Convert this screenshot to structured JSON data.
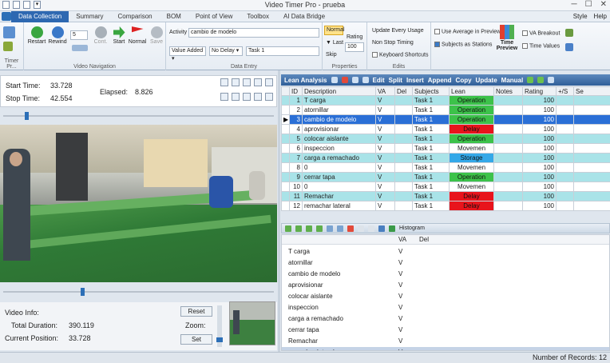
{
  "window": {
    "title": "Video Timer Pro - prueba"
  },
  "tabs": [
    "Data Collection",
    "Summary",
    "Comparison",
    "BOM",
    "Point of View",
    "Toolbox",
    "AI Data Bridge"
  ],
  "tab_right": {
    "style": "Style",
    "help": "Help"
  },
  "ribbon": {
    "groups": {
      "timer": "Timer Pr...",
      "nav": "Video Navigation",
      "entry": "Data Entry",
      "props": "Properties",
      "edits": "Edits"
    },
    "nav": {
      "restart": "Restart",
      "rewind": "Rewind",
      "step": "5",
      "cont": "Cont.",
      "start": "Start",
      "normal": "Normal",
      "save": "Save"
    },
    "entry": {
      "activity_label": "Activity",
      "activity_value": "cambio de modelo",
      "value_added": "Value Added",
      "no_delay": "No Delay",
      "task": "Task 1"
    },
    "props": {
      "normal": "Normal",
      "rating_label": "Rating",
      "rating_value": "100",
      "last": "▼ Last",
      "skip": "Skip"
    },
    "edits": {
      "update_every": "Update Every Usage",
      "non_stop": "Non Stop Timing",
      "keyboard": "Keyboard Shortcuts"
    },
    "preview": {
      "use_avg": "Use Average in Preview",
      "subjects": "Subjects as Stations",
      "time_preview": "Time Preview",
      "va_breakout": "VA Breakout",
      "time_values": "Time Values"
    }
  },
  "times": {
    "start_label": "Start Time:",
    "start_value": "33.728",
    "stop_label": "Stop Time:",
    "stop_value": "42.554",
    "elapsed_label": "Elapsed:",
    "elapsed_value": "8.826"
  },
  "video_info": {
    "label": "Video Info:",
    "duration_label": "Total Duration:",
    "duration_value": "390.119",
    "position_label": "Current Position:",
    "position_value": "33.728",
    "reset": "Reset",
    "zoom": "Zoom:",
    "set": "Set"
  },
  "sliders": {
    "top_progress": 0.08,
    "bottom_progress": 0.29
  },
  "grid_toolbar": {
    "lean_analysis": "Lean Analysis",
    "edit": "Edit",
    "split": "Split",
    "insert": "Insert",
    "append": "Append",
    "copy": "Copy",
    "update": "Update",
    "manual": "Manual"
  },
  "grid": {
    "columns": [
      "ID",
      "Description",
      "VA",
      "Del",
      "Subjects",
      "Lean",
      "Notes",
      "Rating",
      "+/S",
      "Se"
    ],
    "rows": [
      {
        "id": "1",
        "desc": "T carga",
        "va": "V",
        "subj": "Task 1",
        "lean": "Operation",
        "rating": "100",
        "kind": "op"
      },
      {
        "id": "2",
        "desc": "atornillar",
        "va": "V",
        "subj": "Task 1",
        "lean": "Operation",
        "rating": "100",
        "kind": "op"
      },
      {
        "id": "3",
        "desc": "cambio de modelo",
        "va": "V",
        "subj": "Task 1",
        "lean": "Operation",
        "rating": "100",
        "kind": "op"
      },
      {
        "id": "4",
        "desc": "aprovisionar",
        "va": "V",
        "subj": "Task 1",
        "lean": "Delay",
        "rating": "100",
        "kind": "del"
      },
      {
        "id": "5",
        "desc": "colocar aislante",
        "va": "V",
        "subj": "Task 1",
        "lean": "Operation",
        "rating": "100",
        "kind": "op"
      },
      {
        "id": "6",
        "desc": "inspeccion",
        "va": "V",
        "subj": "Task 1",
        "lean": "Movemen",
        "rating": "100",
        "kind": "mov"
      },
      {
        "id": "7",
        "desc": "carga a remachado",
        "va": "V",
        "subj": "Task 1",
        "lean": "Storage",
        "rating": "100",
        "kind": "stor"
      },
      {
        "id": "8",
        "desc": "0",
        "va": "V",
        "subj": "Task 1",
        "lean": "Movemen",
        "rating": "100",
        "kind": "mov"
      },
      {
        "id": "9",
        "desc": "cerrar tapa",
        "va": "V",
        "subj": "Task 1",
        "lean": "Operation",
        "rating": "100",
        "kind": "op"
      },
      {
        "id": "10",
        "desc": "0",
        "va": "V",
        "subj": "Task 1",
        "lean": "Movemen",
        "rating": "100",
        "kind": "mov"
      },
      {
        "id": "11",
        "desc": "Remachar",
        "va": "V",
        "subj": "Task 1",
        "lean": "Delay",
        "rating": "100",
        "kind": "del"
      },
      {
        "id": "12",
        "desc": "remachar lateral",
        "va": "V",
        "subj": "Task 1",
        "lean": "Delay",
        "rating": "100",
        "kind": "del"
      }
    ],
    "selected_index": 2
  },
  "lower_toolbar": {
    "histogram": "Histogram"
  },
  "lower": {
    "columns": [
      "",
      "VA",
      "Del"
    ],
    "rows": [
      {
        "desc": "T carga",
        "va": "V"
      },
      {
        "desc": "atornillar",
        "va": "V"
      },
      {
        "desc": "cambio de modelo",
        "va": "V"
      },
      {
        "desc": "aprovisionar",
        "va": "V"
      },
      {
        "desc": "colocar aislante",
        "va": "V"
      },
      {
        "desc": "inspeccion",
        "va": "V"
      },
      {
        "desc": "carga a remachado",
        "va": "V"
      },
      {
        "desc": "cerrar tapa",
        "va": "V"
      },
      {
        "desc": "Remachar",
        "va": "V"
      },
      {
        "desc": "remachar lateral",
        "va": "V"
      }
    ]
  },
  "status": {
    "records": "Number of Records: 12"
  },
  "colors": {
    "operation": "#3cc24a",
    "delay": "#e8141c",
    "storage": "#34a8e8",
    "selected": "#2a6fd6",
    "alt_row": "#a9e3e8"
  }
}
